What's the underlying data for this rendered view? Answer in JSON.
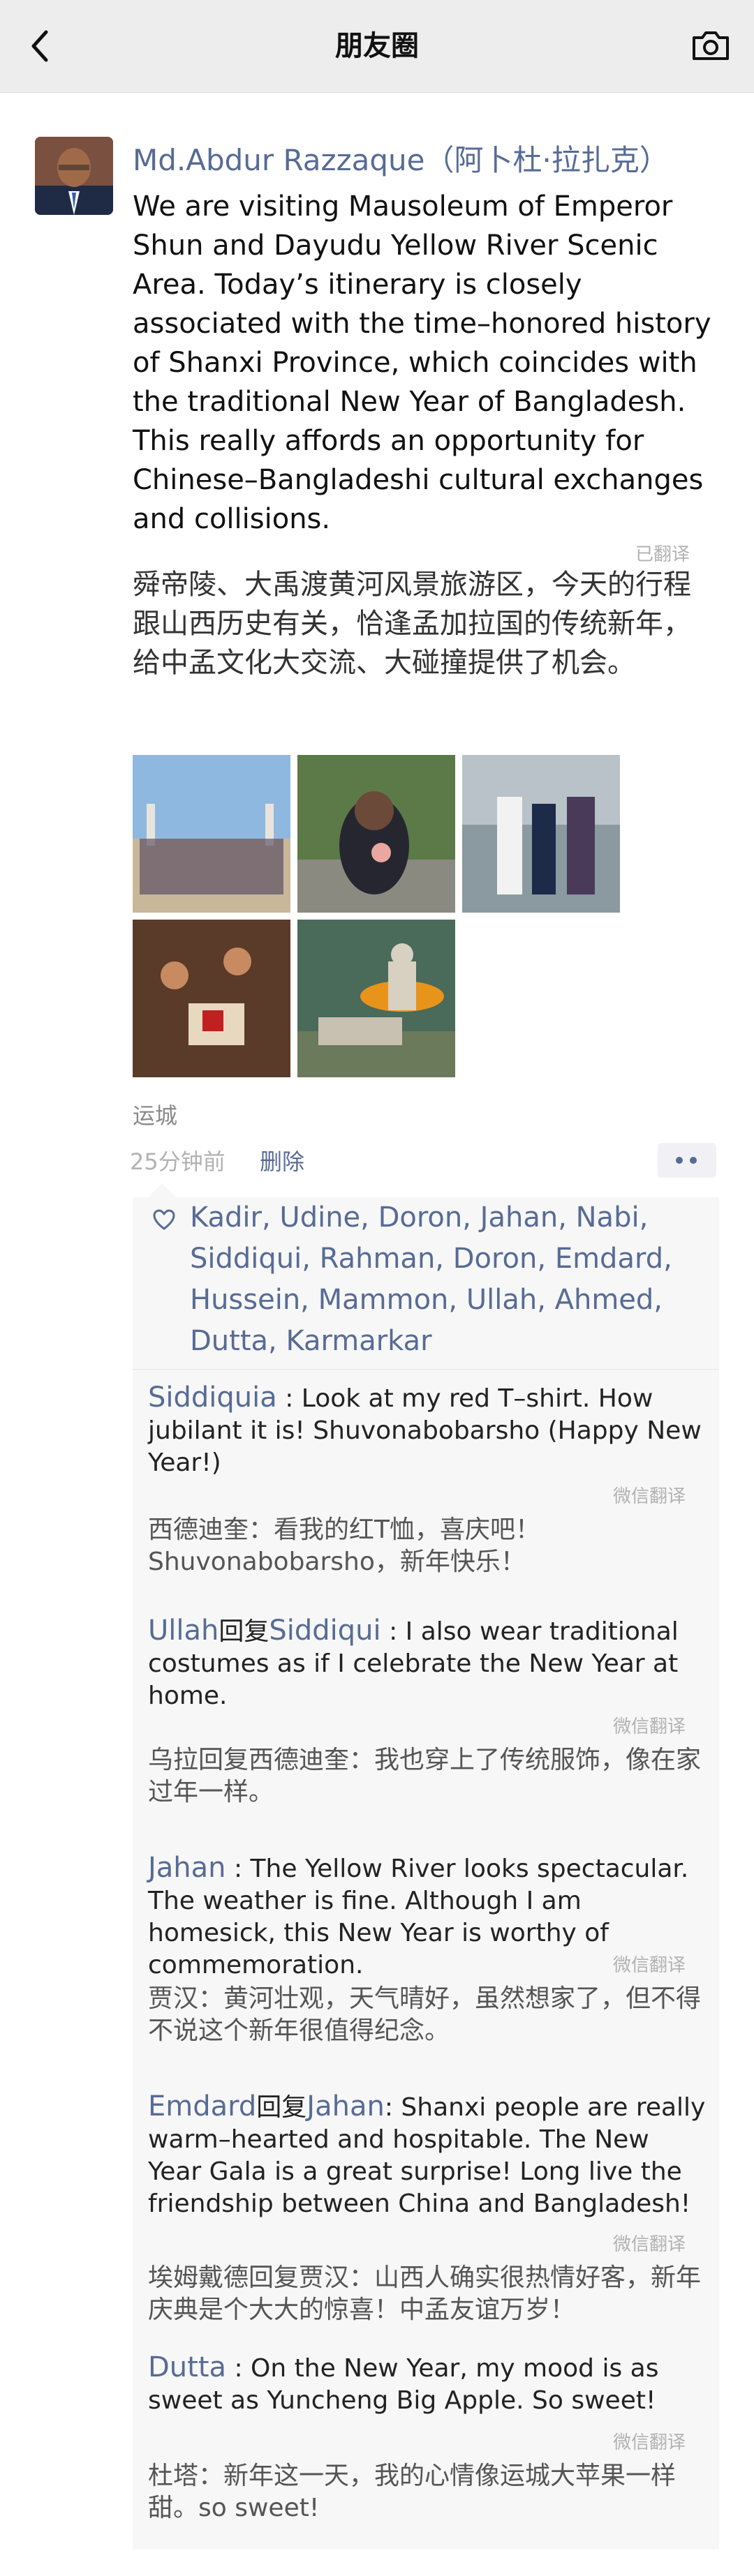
{
  "nav": {
    "title": "朋友圈",
    "back_icon": "chevron-left-icon",
    "camera_icon": "camera-icon"
  },
  "post": {
    "author": "Md.Abdur Razzaque（阿卜杜·拉扎克）",
    "text_en": "We are visiting Mausoleum of Emperor Shun and Dayudu Yellow River Scenic Area. Today’s itinerary is closely associated with the time–honored history of Shanxi Province, which coincides with the traditional New Year of Bangladesh. This really affords an opportunity for Chinese–Bangladeshi cultural exchanges and collisions.",
    "translate_label": "已翻译",
    "text_cn": "舜帝陵、大禹渡黄河风景旅游区，今天的行程跟山西历史有关，恰逢孟加拉国的传统新年，给中孟文化大交流、大碰撞提供了机会。",
    "location": "运城",
    "time": "25分钟前",
    "delete_label": "删除",
    "more_icon": "more-dots-icon"
  },
  "likes": {
    "icon": "heart-icon",
    "names_text": "Kadir,  Udine,  Doron,  Jahan,  Nabi,  Siddiqui,  Rahman,  Doron,  Emdard,  Hussein,  Mammon,  Ullah,  Ahmed,  Dutta,  Karmarkar"
  },
  "comments": [
    {
      "name": "Siddiquia",
      "reply_word": "",
      "reply_to": "",
      "text": " : Look at my red T–shirt. How jubilant it is! Shuvonabobarsho (Happy New Year!)",
      "translate_label": "微信翻译",
      "cn": "西德迪奎：看我的红T恤，喜庆吧！Shuvonabobarsho，新年快乐！"
    },
    {
      "name": "Ullah",
      "reply_word": "回复",
      "reply_to": "Siddiqui",
      "text": " : I also wear traditional costumes as if I celebrate the New Year at home.",
      "translate_label": "微信翻译",
      "cn": "乌拉回复西德迪奎：我也穿上了传统服饰，像在家过年一样。"
    },
    {
      "name": "Jahan",
      "reply_word": "",
      "reply_to": "",
      "text": " : The Yellow River looks spectacular. The weather is fine. Although I am homesick, this New Year is worthy of commemoration.",
      "translate_label": "微信翻译",
      "cn": "贾汉：黄河壮观，天气晴好，虽然想家了，但不得不说这个新年很值得纪念。"
    },
    {
      "name": "Emdard",
      "reply_word": "回复",
      "reply_to": "Jahan",
      "text": ": Shanxi people are really warm–hearted and hospitable. The New Year Gala is a great surprise! Long live the friendship between China and Bangladesh!",
      "translate_label": "微信翻译",
      "cn": "埃姆戴德回复贾汉：山西人确实很热情好客，新年庆典是个大大的惊喜！中孟友谊万岁！"
    },
    {
      "name": "Dutta",
      "reply_word": "",
      "reply_to": "",
      "text": "  : On the New Year, my mood is as sweet as Yuncheng Big Apple. So sweet!",
      "translate_label": "微信翻译",
      "cn": "杜塔：新年这一天，我的心情像运城大苹果一样甜。so sweet!"
    }
  ],
  "colors": {
    "link": "#576b95",
    "nav_bg": "#ededed",
    "comment_bg": "#f7f7f7",
    "muted": "#b2b2b2"
  }
}
